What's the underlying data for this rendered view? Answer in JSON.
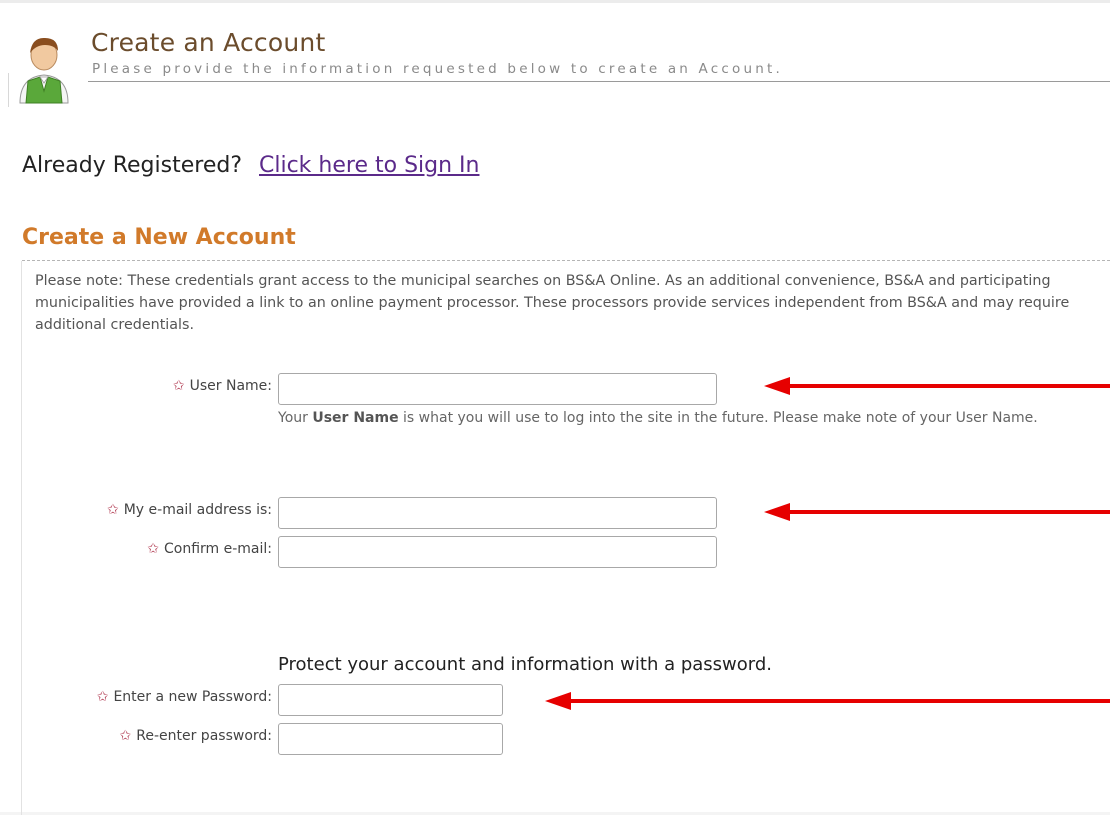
{
  "header": {
    "title": "Create an Account",
    "subtitle": "Please provide the information requested below to create an Account."
  },
  "signin": {
    "prompt": "Already Registered?",
    "link": "Click here to Sign In"
  },
  "section": {
    "title": "Create a New Account",
    "note": "Please note: These credentials grant access to the municipal searches on BS&A Online. As an additional convenience, BS&A and participating municipalities have provided a link to an online payment processor. These processors provide services independent from BS&A and may require additional credentials."
  },
  "form": {
    "username": {
      "label": "User Name:",
      "value": "",
      "help_prefix": "Your ",
      "help_bold": "User Name",
      "help_suffix": " is what you will use to log into the site in the future. Please make note of your User Name."
    },
    "email": {
      "label": "My e-mail address is:",
      "value": ""
    },
    "confirm_email": {
      "label": "Confirm e-mail:",
      "value": ""
    },
    "password_heading": "Protect your account and information with a password.",
    "password": {
      "label": "Enter a new Password:",
      "value": ""
    },
    "reenter_password": {
      "label": "Re-enter password:",
      "value": ""
    }
  },
  "icons": {
    "required": "star-outline-icon",
    "avatar": "user-avatar-icon",
    "arrows": "red-arrow-left-icon"
  },
  "colors": {
    "accent": "#d17a2a",
    "title": "#6b4c2c",
    "link": "#5b2a8a",
    "required_star": "#b5445a",
    "arrow": "#e60000"
  }
}
